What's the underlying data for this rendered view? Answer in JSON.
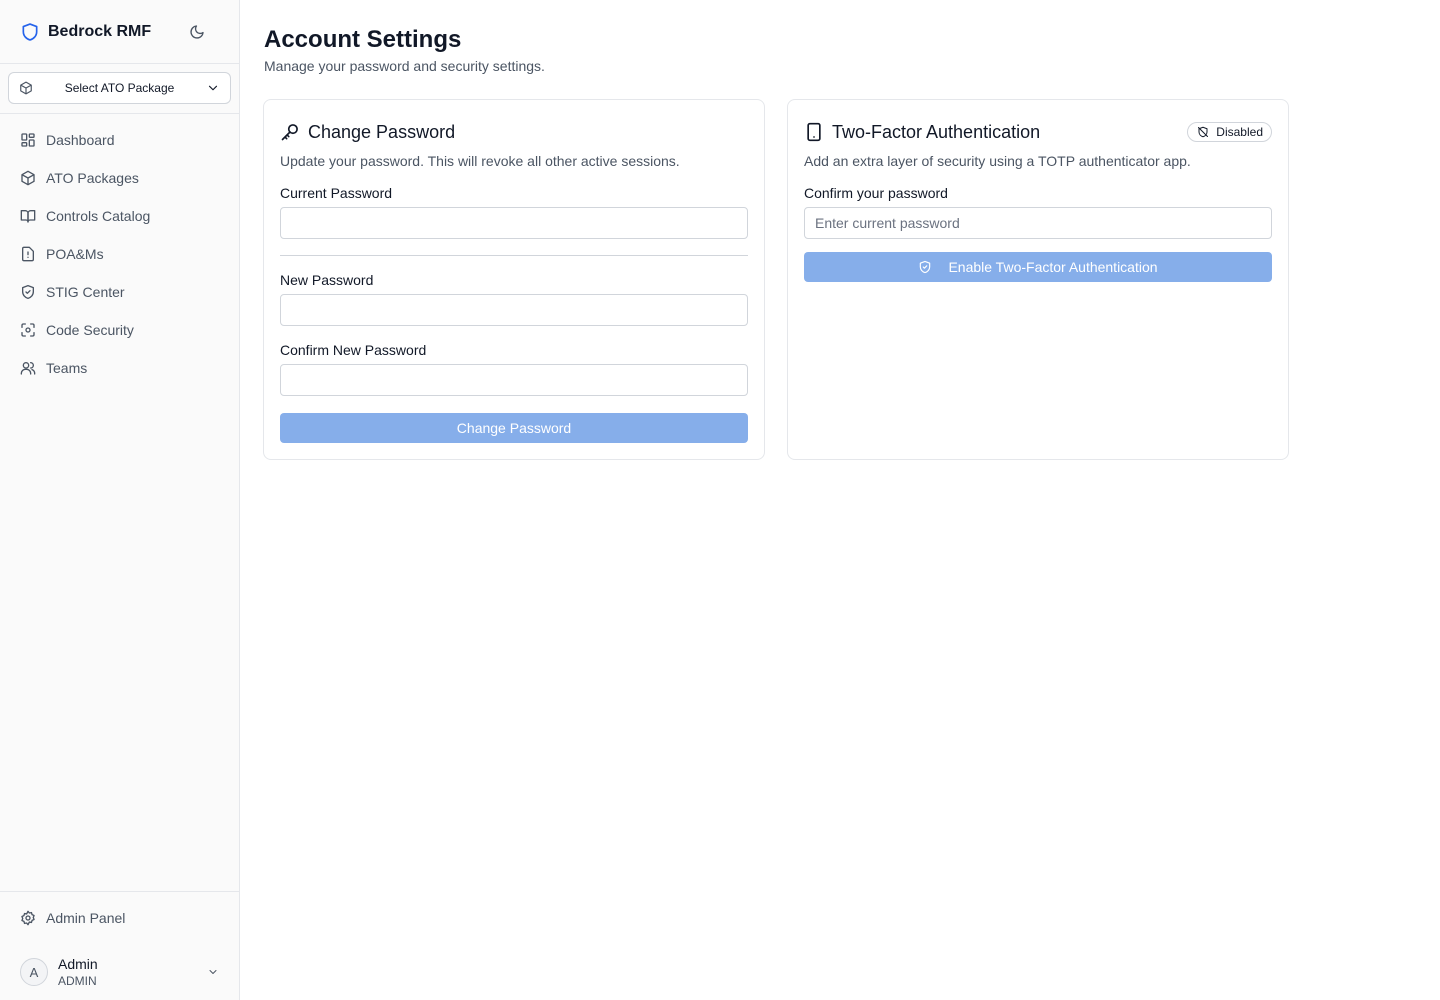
{
  "brand": {
    "name": "Bedrock RMF",
    "logo_icon": "shield-icon"
  },
  "package_selector": {
    "label": "Select ATO Package"
  },
  "nav": [
    {
      "label": "Dashboard",
      "icon": "dashboard-icon"
    },
    {
      "label": "ATO Packages",
      "icon": "package-icon"
    },
    {
      "label": "Controls Catalog",
      "icon": "book-icon"
    },
    {
      "label": "POA&Ms",
      "icon": "file-alert-icon"
    },
    {
      "label": "STIG Center",
      "icon": "shield-check-icon"
    },
    {
      "label": "Code Security",
      "icon": "scan-icon"
    },
    {
      "label": "Teams",
      "icon": "users-icon"
    }
  ],
  "admin": {
    "label": "Admin Panel"
  },
  "user": {
    "initial": "A",
    "name": "Admin",
    "role": "ADMIN"
  },
  "page": {
    "title": "Account Settings",
    "subtitle": "Manage your password and security settings."
  },
  "change_password": {
    "title": "Change Password",
    "description": "Update your password. This will revoke all other active sessions.",
    "current_label": "Current Password",
    "current_value": "",
    "new_label": "New Password",
    "new_value": "",
    "confirm_label": "Confirm New Password",
    "confirm_value": "",
    "button": "Change Password"
  },
  "two_factor": {
    "title": "Two-Factor Authentication",
    "status": "Disabled",
    "description": "Add an extra layer of security using a TOTP authenticator app.",
    "confirm_label": "Confirm your password",
    "confirm_placeholder": "Enter current password",
    "button": "Enable Two-Factor Authentication"
  },
  "colors": {
    "accent": "#2563eb",
    "button_disabled": "#86aeea",
    "sidebar_bg": "#fafafa",
    "border": "#e5e7eb"
  }
}
